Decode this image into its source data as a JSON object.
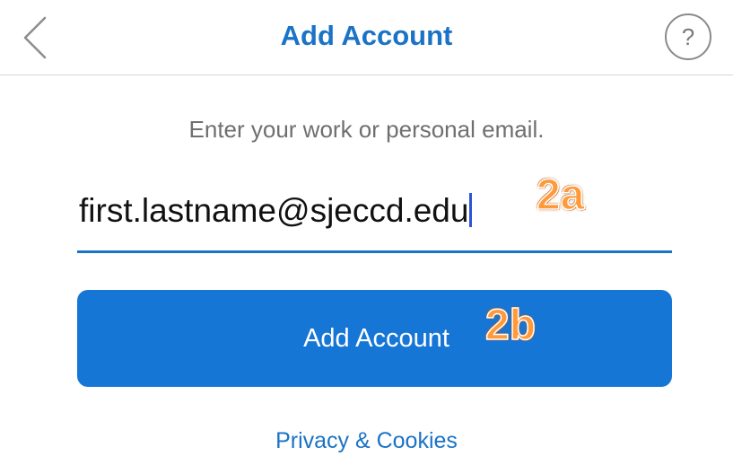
{
  "header": {
    "title": "Add Account",
    "back_icon": "chevron-left-icon",
    "help_label": "?",
    "help_icon": "question-circle-icon"
  },
  "form": {
    "prompt": "Enter your work or personal email.",
    "email_value": "first.lastname@sjeccd.edu",
    "submit_label": "Add Account"
  },
  "annotations": {
    "step_a": "2a",
    "step_b": "2b"
  },
  "footer": {
    "privacy_label": "Privacy & Cookies"
  },
  "colors": {
    "accent": "#1a73c6",
    "button": "#1676d6",
    "annotation": "#ff9a3c"
  }
}
